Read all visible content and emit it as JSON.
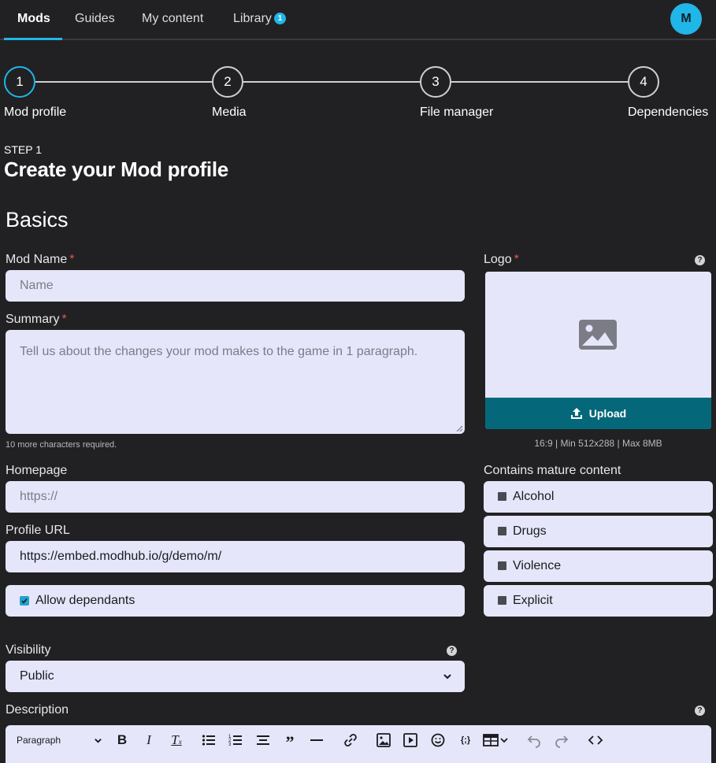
{
  "nav": {
    "tabs": [
      {
        "label": "Mods"
      },
      {
        "label": "Guides"
      },
      {
        "label": "My content"
      },
      {
        "label": "Library",
        "badge": "1"
      }
    ],
    "avatar": "M"
  },
  "stepper": [
    {
      "num": "1",
      "label": "Mod profile"
    },
    {
      "num": "2",
      "label": "Media"
    },
    {
      "num": "3",
      "label": "File manager"
    },
    {
      "num": "4",
      "label": "Dependencies"
    }
  ],
  "page": {
    "step": "STEP 1",
    "title": "Create your Mod profile",
    "section": "Basics"
  },
  "form": {
    "mod_name": {
      "label": "Mod Name",
      "required": "*",
      "placeholder": "Name"
    },
    "summary": {
      "label": "Summary",
      "required": "*",
      "placeholder": "Tell us about the changes your mod makes to the game in 1 paragraph.",
      "hint": "10 more characters required."
    },
    "homepage": {
      "label": "Homepage",
      "placeholder": "https://"
    },
    "profile_url": {
      "label": "Profile URL",
      "value": "https://embed.modhub.io/g/demo/m/"
    },
    "allow_dependants": {
      "label": "Allow dependants",
      "checked": true
    },
    "visibility": {
      "label": "Visibility",
      "value": "Public"
    },
    "description": {
      "label": "Description"
    },
    "logo": {
      "label": "Logo",
      "required": "*",
      "upload": "Upload",
      "hint": "16:9 | Min 512x288 | Max 8MB"
    },
    "mature": {
      "label": "Contains mature content",
      "options": [
        {
          "label": "Alcohol"
        },
        {
          "label": "Drugs"
        },
        {
          "label": "Violence"
        },
        {
          "label": "Explicit"
        }
      ]
    }
  },
  "editor": {
    "paragraph": "Paragraph",
    "tools": [
      "bold-icon",
      "italic-icon",
      "clear-format-icon",
      "bullet-list-icon",
      "numbered-list-icon",
      "align-center-icon",
      "quote-icon",
      "horizontal-rule-icon",
      "link-icon",
      "image-icon",
      "video-icon",
      "emoji-icon",
      "code-variable-icon",
      "table-icon",
      "undo-icon",
      "redo-icon",
      "source-code-icon"
    ]
  },
  "colors": {
    "background": "#212123",
    "accent": "#20b6e8",
    "input_bg": "#e6e6fa",
    "upload_bg": "#05687a",
    "required": "#e0554e"
  }
}
